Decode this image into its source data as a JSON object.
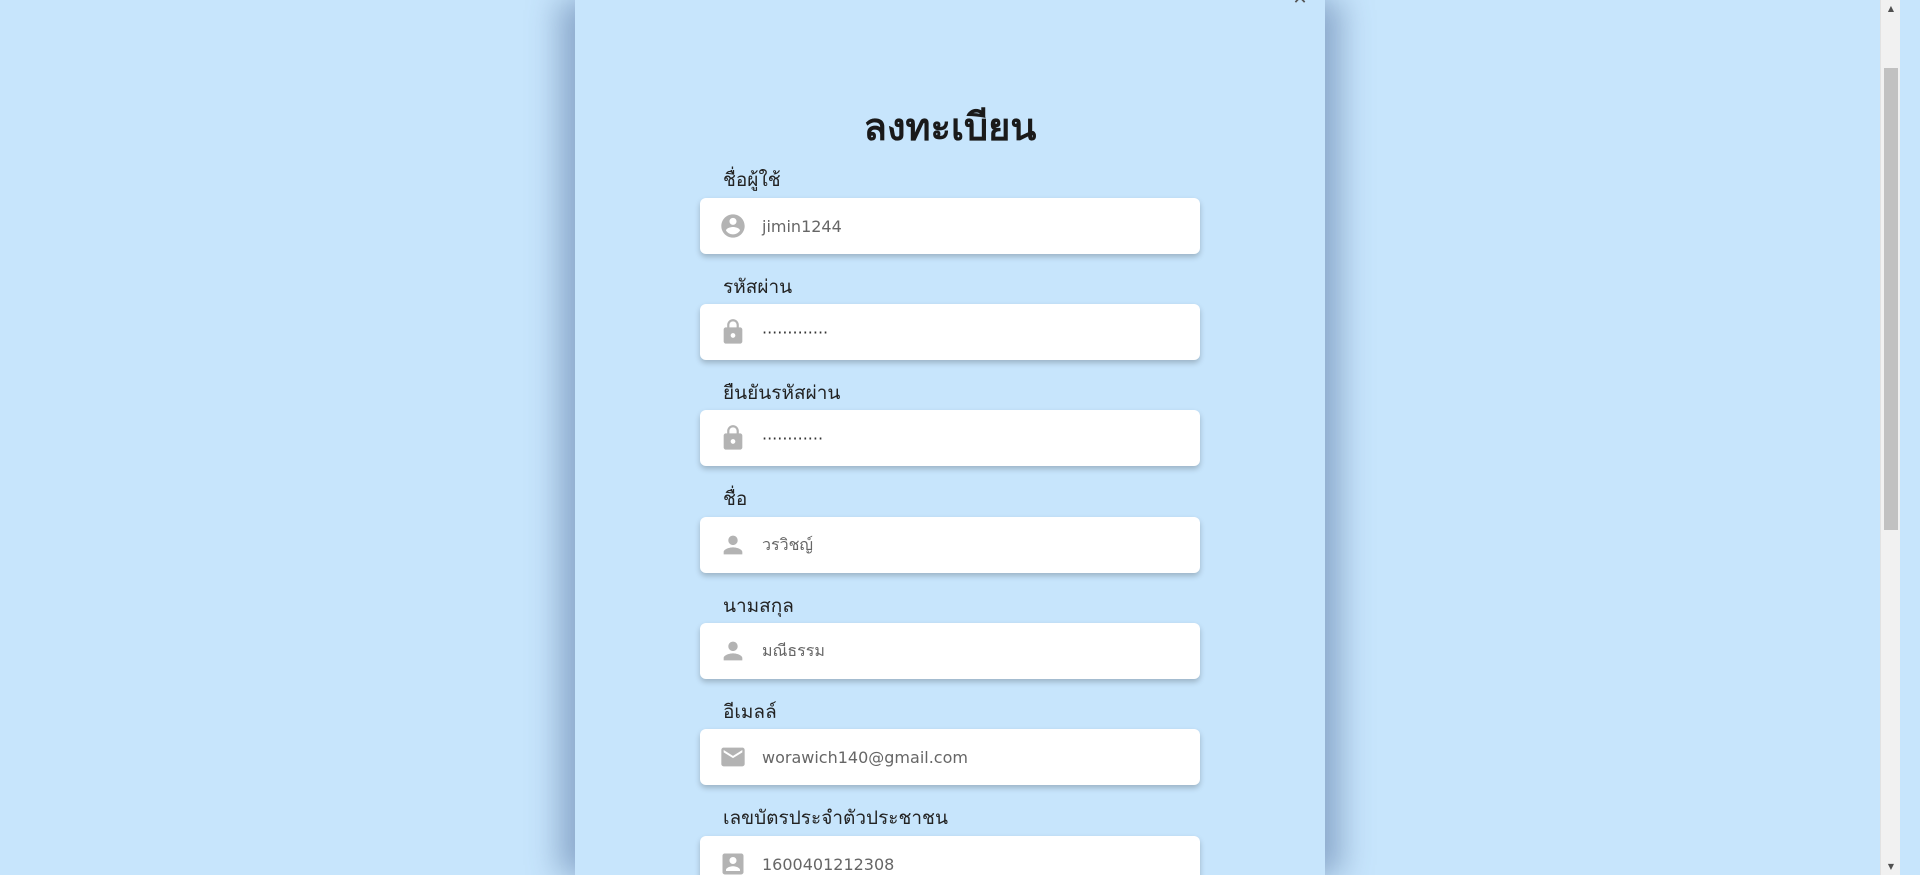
{
  "form": {
    "title": "ลงทะเบียน",
    "close_icon": "close-icon",
    "fields": [
      {
        "label": "ชื่อผู้ใช้",
        "value": "jimin1244",
        "icon": "account-circle-icon"
      },
      {
        "label": "รหัสผ่าน",
        "value": "·············",
        "icon": "lock-icon"
      },
      {
        "label": "ยืนยันรหัสผ่าน",
        "value": "············",
        "icon": "lock-icon"
      },
      {
        "label": "ชื่อ",
        "value": "วรวิชญ์",
        "icon": "person-icon"
      },
      {
        "label": "นามสกุล",
        "value": "มณีธรรม",
        "icon": "person-icon"
      },
      {
        "label": "อีเมลล์",
        "value": "worawich140@gmail.com",
        "icon": "mail-icon"
      },
      {
        "label": "เลขบัตรประจำตัวประชาชน",
        "value": "1600401212308",
        "icon": "id-card-icon"
      }
    ]
  },
  "colors": {
    "background": "#c7e5fc",
    "input_bg": "#ffffff",
    "icon": "#b3b3b3"
  }
}
